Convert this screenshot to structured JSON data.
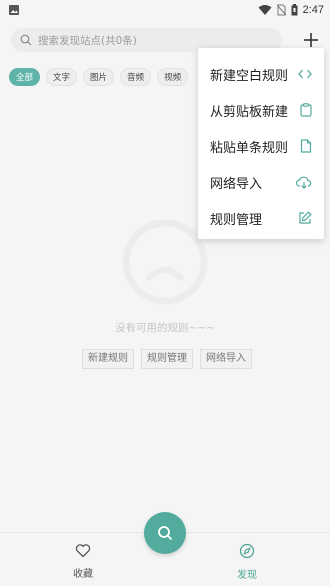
{
  "status_bar": {
    "time": "2:47"
  },
  "search": {
    "placeholder": "搜索发现站点(共0条)"
  },
  "chips": [
    {
      "label": "全部",
      "active": true
    },
    {
      "label": "文字",
      "active": false
    },
    {
      "label": "图片",
      "active": false
    },
    {
      "label": "音频",
      "active": false
    },
    {
      "label": "视频",
      "active": false
    }
  ],
  "menu": {
    "items": [
      {
        "label": "新建空白规则",
        "icon": "code-icon"
      },
      {
        "label": "从剪贴板新建",
        "icon": "clipboard-icon"
      },
      {
        "label": "粘贴单条规则",
        "icon": "file-icon"
      },
      {
        "label": "网络导入",
        "icon": "cloud-download-icon"
      },
      {
        "label": "规则管理",
        "icon": "edit-icon"
      }
    ]
  },
  "empty": {
    "message": "没有可用的规则~~~",
    "actions": [
      "新建规则",
      "规则管理",
      "网络导入"
    ]
  },
  "bottom_nav": {
    "favorites_label": "收藏",
    "discover_label": "发现"
  },
  "colors": {
    "accent": "#52ab9c",
    "chip_active": "#5fb4a9",
    "background": "#f5f5f5"
  }
}
